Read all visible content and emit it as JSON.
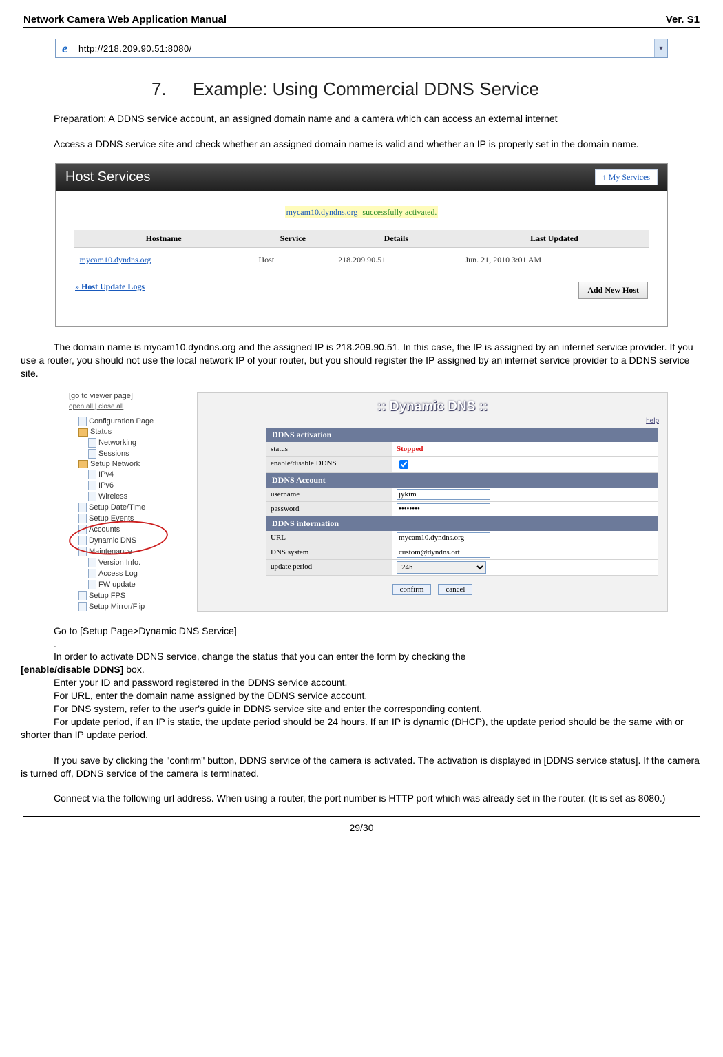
{
  "header": {
    "title_left": "Network Camera Web Application Manual",
    "title_right": "Ver. S1"
  },
  "address_bar": {
    "url": "http://218.209.90.51:8080/"
  },
  "section": {
    "number": "7.",
    "title": "Example: Using Commercial DDNS Service"
  },
  "para": {
    "p1": "Preparation: A DDNS service account, an assigned domain name and a camera which can access an external internet",
    "p2": "Access a DDNS service site and check whether an assigned domain name is valid and whether an IP is properly set in the domain name.",
    "p3": "The domain name is mycam10.dyndns.org and the assigned IP is 218.209.90.51. In this case, the IP is assigned by an internet service provider. If you use a router, you should not use the local network IP of your router, but you should register the IP assigned by an internet service provider to a DDNS service site.",
    "p4a": "Go to [Setup Page>Dynamic DNS Service]",
    "p4b": ".",
    "p5a": "In order to activate DDNS service, change the status that you can enter the form by checking the ",
    "enable_box": "[enable/disable DDNS]",
    "p5b": " box.",
    "p6": "Enter your ID and password registered in the DDNS service account.",
    "p7": "For URL, enter the domain name assigned by the DDNS service account.",
    "p8": "For DNS system, refer to the user's guide in DDNS service site and enter the corresponding content.",
    "p9": "For update period, if an IP is static, the update period should be 24 hours. If an IP is dynamic (DHCP), the update period should be the same with or shorter than IP update period.",
    "p10": "If you save by clicking the \"confirm\" button, DDNS service of the camera is activated. The activation is displayed in [DDNS service status]. If the camera is turned off, DDNS service of the camera is terminated.",
    "p11": "Connect via the following url address. When using a router, the port number is HTTP port which was already set in the router. (It is set as 8080.)"
  },
  "hostserv": {
    "title": "Host Services",
    "my_services": "↑ My Services",
    "notice_domain": "mycam10.dyndns.org",
    "notice_suffix": " successfully activated.",
    "th": {
      "hostname": "Hostname",
      "service": "Service",
      "details": "Details",
      "updated": "Last Updated"
    },
    "row": {
      "hostname": "mycam10.dyndns.org",
      "service": "Host",
      "details": "218.209.90.51",
      "updated": "Jun. 21, 2010 3:01 AM"
    },
    "update_logs": "» Host Update Logs",
    "add_new_host": "Add New Host"
  },
  "tree": {
    "goto": "[go to viewer page]",
    "open_close": "open all | close all",
    "items": [
      "Configuration Page",
      "Status",
      "Networking",
      "Sessions",
      "Setup Network",
      "IPv4",
      "IPv6",
      "Wireless",
      "Setup Date/Time",
      "Setup Events",
      "Accounts",
      "Dynamic DNS",
      "Maintenance",
      "Version Info.",
      "Access Log",
      "FW update",
      "Setup FPS",
      "Setup Mirror/Flip"
    ]
  },
  "dyn": {
    "title": ":: Dynamic DNS ::",
    "help": "help",
    "sectA": "DDNS activation",
    "status_label": "status",
    "status_value": "Stopped",
    "enable_label": "enable/disable DDNS",
    "sectB": "DDNS Account",
    "user_label": "username",
    "user_value": "jykim",
    "pass_label": "password",
    "pass_value": "••••••••",
    "sectC": "DDNS information",
    "url_label": "URL",
    "url_value": "mycam10.dyndns.org",
    "dnss_label": "DNS system",
    "dnss_value": "custom@dyndns.ort",
    "period_label": "update period",
    "period_value": "24h",
    "confirm": "confirm",
    "cancel": "cancel"
  },
  "footer": {
    "page": "29/30"
  }
}
